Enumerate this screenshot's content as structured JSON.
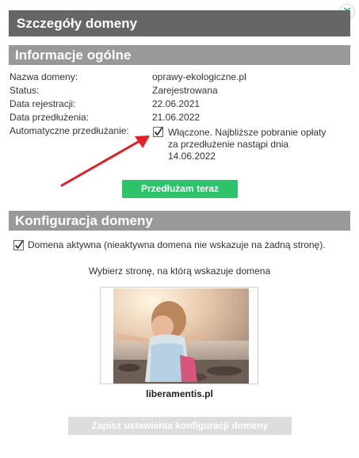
{
  "dialog": {
    "title": "Szczegóły domeny",
    "close_symbol": "×"
  },
  "general": {
    "header": "Informacje ogólne",
    "rows": [
      {
        "label": "Nazwa domeny:",
        "value": "oprawy-ekologiczne.pl"
      },
      {
        "label": "Status:",
        "value": "Zarejestrowana"
      },
      {
        "label": "Data rejestracji:",
        "value": "22.06.2021"
      },
      {
        "label": "Data przedłużenia:",
        "value": "21.06.2022"
      }
    ],
    "auto_renew_label": "Automatyczne przedłużanie:",
    "auto_renew_checked": true,
    "auto_renew_note": "Włączone. Najbliższe pobranie opłaty za przedłużenie nastąpi dnia 14.06.2022",
    "renew_button": "Przedłużam teraz"
  },
  "config": {
    "header": "Konfiguracja domeny",
    "domain_active_checked": true,
    "domain_active_label": "Domena aktywna (nieaktywna domena nie wskazuje na żadną stronę).",
    "choose_site_label": "Wybierz stronę, na którą wskazuje domena",
    "site_name": "liberamentis.pl",
    "save_button": "Zapisz ustawienia konfiguracji domeny"
  },
  "icons": {
    "close": "close-icon",
    "checkbox": "checked-checkbox-icon",
    "annotation_arrow": "red-arrow-icon"
  },
  "colors": {
    "title_bar": "#666666",
    "section_header": "#999999",
    "renew_button": "#2cc36b",
    "save_button_disabled": "#dddddd",
    "close_icon": "#2fb86a",
    "annotation_arrow": "#e31e24"
  }
}
